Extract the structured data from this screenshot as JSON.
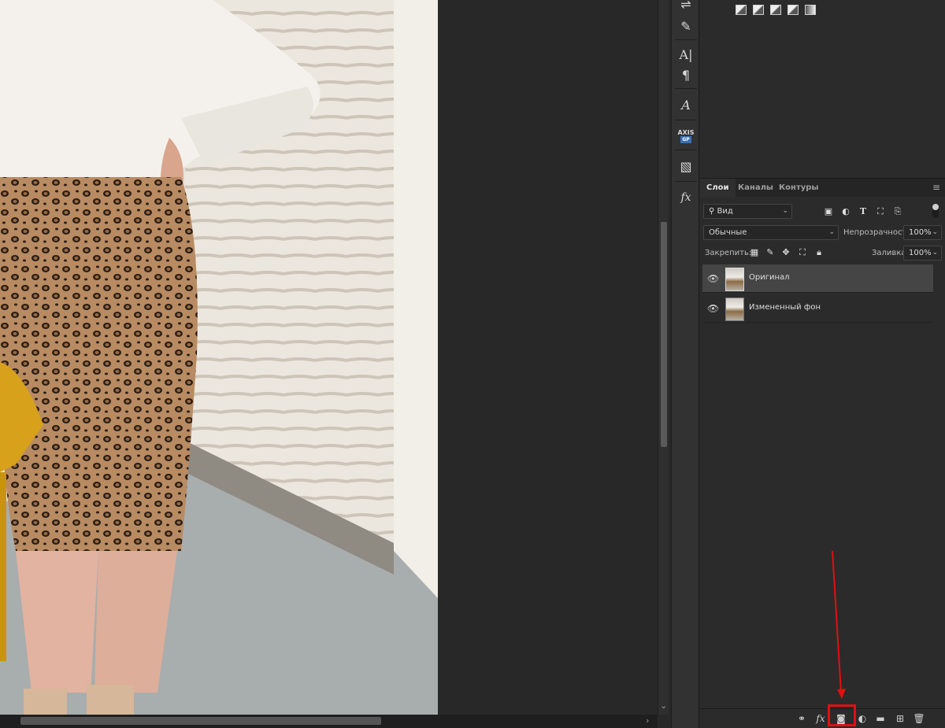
{
  "adjustments": {
    "icons": [
      "curves-icon",
      "exposure-icon",
      "gradient-map-icon",
      "channel-mixer-icon",
      "solid-gradient-icon"
    ]
  },
  "tools": [
    "brush-settings-icon",
    "brush-presets-icon",
    "character-icon",
    "paragraph-icon",
    "glyphs-icon",
    "axis-icon",
    "library-icon",
    "fx-icon"
  ],
  "axis_label": "AXIS",
  "axis_sub": "GP",
  "tabs": {
    "layers": "Слои",
    "channels": "Каналы",
    "paths": "Контуры"
  },
  "filter": {
    "label": "Вид"
  },
  "blend": {
    "mode": "Обычные",
    "opacity_label": "Непрозрачность:",
    "opacity_value": "100%"
  },
  "lock": {
    "label": "Закрепить:",
    "fill_label": "Заливка:",
    "fill_value": "100%"
  },
  "layers": [
    {
      "name": "Оригинал",
      "visible": true,
      "selected": true
    },
    {
      "name": "Измененный фон",
      "visible": true,
      "selected": false
    }
  ],
  "bottom_icons": [
    "link-icon",
    "fx-icon",
    "mask-icon",
    "adjustment-icon",
    "folder-icon",
    "new-layer-icon",
    "trash-icon"
  ],
  "colors": {
    "highlight": "#e10f0f",
    "panel": "#2b2b2b",
    "selected_row": "#454545"
  }
}
